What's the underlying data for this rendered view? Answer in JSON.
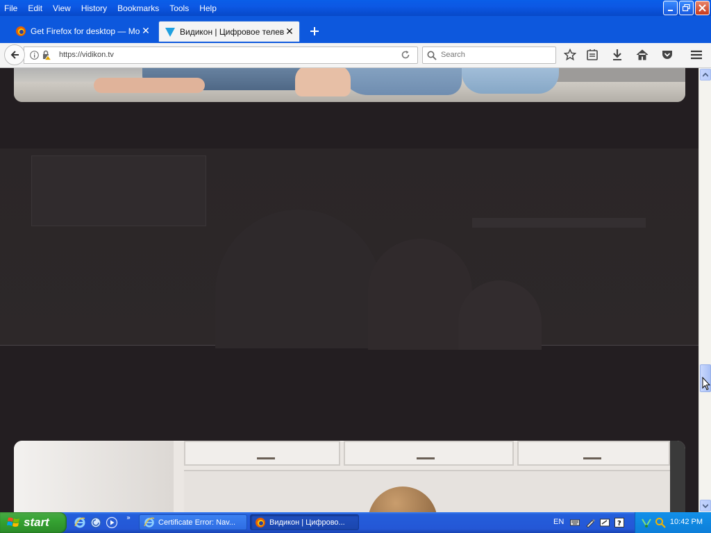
{
  "menu": [
    "File",
    "Edit",
    "View",
    "History",
    "Bookmarks",
    "Tools",
    "Help"
  ],
  "tabs": [
    {
      "label": "Get Firefox for desktop — Mo...",
      "active": false,
      "favicon": "firefox-icon"
    },
    {
      "label": "Видикон | Цифровое телев...",
      "active": true,
      "favicon": "vidikon-icon"
    }
  ],
  "urlbar": {
    "url": "https://vidikon.tv"
  },
  "search": {
    "placeholder": "Search"
  },
  "toolbar_icons": [
    "bookmark-star-icon",
    "reading-list-icon",
    "download-icon",
    "home-icon",
    "pocket-icon",
    "hamburger-menu-icon"
  ],
  "taskbar": {
    "start_label": "start",
    "items": [
      {
        "label": "Certificate Error: Nav...",
        "icon": "ie-icon"
      },
      {
        "label": "Видикон | Цифрово...",
        "icon": "firefox-icon"
      }
    ],
    "language": "EN",
    "clock": "10:42 PM"
  },
  "colors": {
    "xp_blue": "#0c58e4",
    "page_bg": "#231e21",
    "start_green": "#35a332"
  }
}
